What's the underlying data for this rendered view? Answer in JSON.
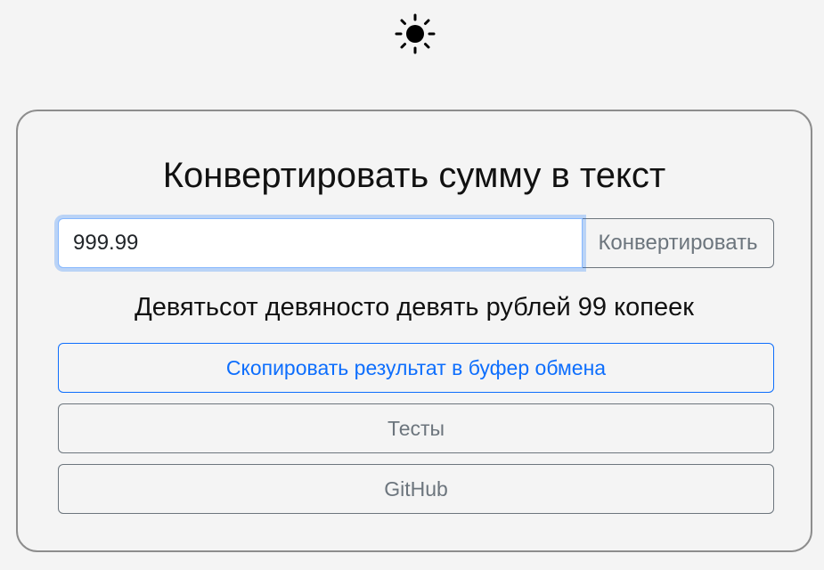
{
  "theme_toggle": {
    "icon": "sun-icon"
  },
  "converter": {
    "title": "Конвертировать сумму в текст",
    "amount_value": "999.99",
    "convert_label": "Конвертировать",
    "result_text": "Девятьсот девяносто девять рублей 99 копеек",
    "copy_label": "Скопировать результат в буфер обмена",
    "tests_label": "Тесты",
    "github_label": "GitHub"
  },
  "colors": {
    "primary": "#0d6efd",
    "secondary": "#6c757d",
    "background": "#f4f4f4",
    "card_border": "#8d8d8d"
  }
}
